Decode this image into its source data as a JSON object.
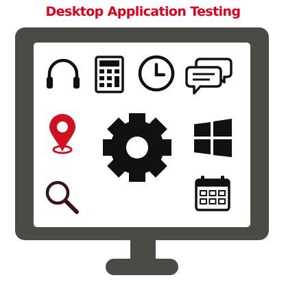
{
  "title": "Desktop Application Testing",
  "colors": {
    "title": "#e0001b",
    "monitor": "#4b4a44",
    "screen": "#ffffff",
    "icon": "#111111",
    "accent": "#d0101f"
  },
  "icons": [
    "headphones-icon",
    "calculator-icon",
    "clock-icon",
    "chat-bubbles-icon",
    "location-pin-icon",
    "gear-icon",
    "windows-logo-icon",
    "search-icon",
    "calendar-icon"
  ]
}
